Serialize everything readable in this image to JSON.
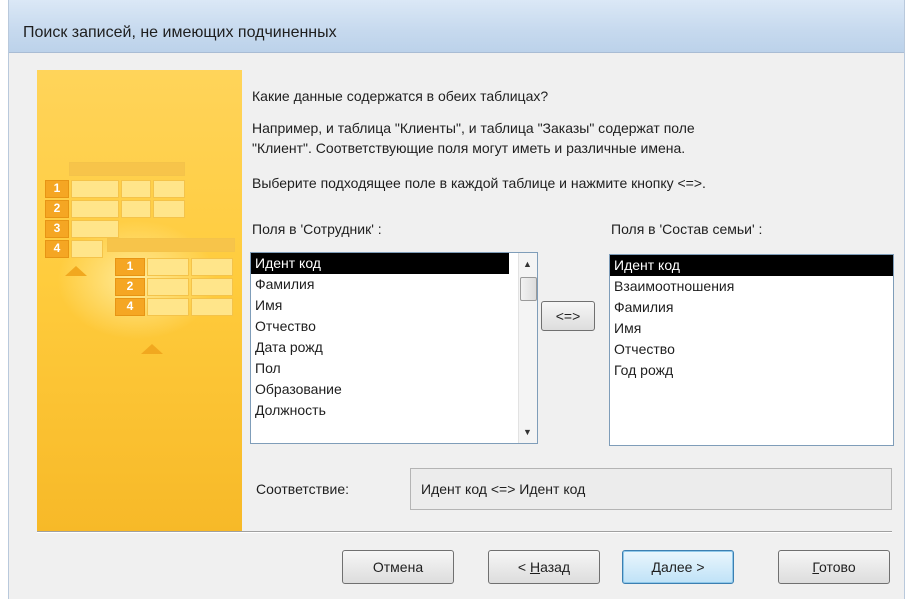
{
  "window": {
    "title": "Поиск записей, не имеющих подчиненных"
  },
  "wizard": {
    "heading": "Какие данные содержатся в обеих таблицах?",
    "example_line1": "Например, и таблица \"Клиенты\", и таблица \"Заказы\" содержат поле",
    "example_line2": "\"Клиент\". Соответствующие поля могут иметь и различные имена.",
    "instruction": "Выберите подходящее поле в каждой таблице и нажмите кнопку <=>."
  },
  "left_list": {
    "label": "Поля в 'Сотрудник' :",
    "items": [
      "Идент код",
      "Фамилия",
      "Имя",
      "Отчество",
      "Дата рожд",
      "Пол",
      "Образование",
      "Должность"
    ],
    "selected": "Идент код"
  },
  "right_list": {
    "label": "Поля в 'Состав семьи' :",
    "items": [
      "Идент код",
      "Взаимоотношения",
      "Фамилия",
      "Имя",
      "Отчество",
      "Год рожд"
    ],
    "selected": "Идент код"
  },
  "match_button": {
    "label": "<=>"
  },
  "match": {
    "label": "Соответствие:",
    "value": "Идент код <=> Идент код"
  },
  "buttons": {
    "cancel": "Отмена",
    "back_prefix": "< ",
    "back_hotkey": "Н",
    "back_rest": "азад",
    "next_hotkey": "Д",
    "next_rest": "алее >",
    "finish_hotkey": "Г",
    "finish_rest": "отово"
  },
  "decor": {
    "table1_rows": [
      "1",
      "2",
      "3",
      "4"
    ],
    "table2_rows": [
      "1",
      "2",
      "4"
    ]
  },
  "icons": {
    "scroll_up": "scroll-up-icon",
    "scroll_down": "scroll-down-icon"
  },
  "colors": {
    "selection": "#000000",
    "art_yellow": "#ffcc3d",
    "title_bar": "#c6d9ee"
  }
}
